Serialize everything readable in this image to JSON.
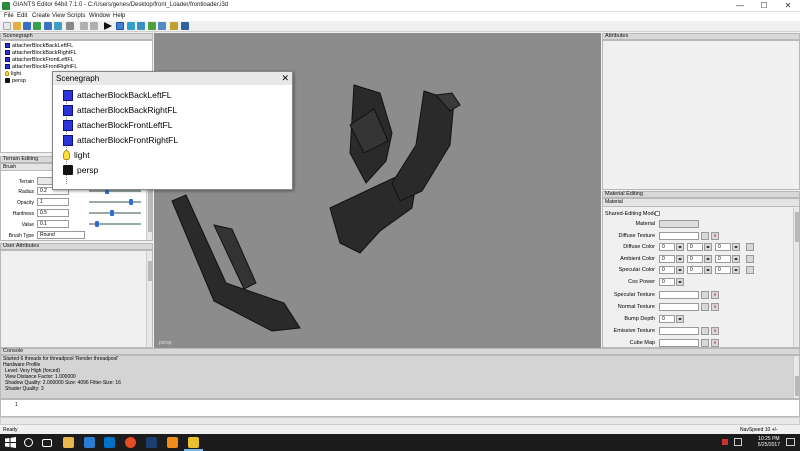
{
  "window": {
    "title": "GIANTS Editor 64bit 7.1.0 - C:/Users/genes/Desktop/front_Loader/frontloader.i3d",
    "minimize": "—",
    "maximize": "☐",
    "close": "✕"
  },
  "menu": [
    "File",
    "Edit",
    "Create",
    "View",
    "Scripts",
    "Window",
    "Help"
  ],
  "scenegraph_panel": {
    "title": "Scenegraph",
    "items": [
      "attacherBlockBackLeftFL",
      "attacherBlockBackRightFL",
      "attacherBlockFrontLeftFL",
      "attacherBlockFrontRightFL",
      "light",
      "persp"
    ]
  },
  "scenegraph_window": {
    "title": "Scenegraph",
    "close": "✕",
    "items": [
      "attacherBlockBackLeftFL",
      "attacherBlockBackRightFL",
      "attacherBlockFrontLeftFL",
      "attacherBlockFrontRightFL",
      "light",
      "persp"
    ]
  },
  "terrain": {
    "title": "Terrain Editing",
    "tab": "Brush",
    "fields": [
      {
        "label": "Terrain",
        "value": ""
      },
      {
        "label": "Radius",
        "value": "0.2"
      },
      {
        "label": "Opacity",
        "value": "1"
      },
      {
        "label": "Hardness",
        "value": "0.5"
      },
      {
        "label": "Value",
        "value": "0.1"
      }
    ],
    "brush_type_label": "Brush Type",
    "brush_type_value": "Round",
    "slider_levels": [
      0.35,
      0.8,
      0.45,
      0.15
    ]
  },
  "user_attributes": {
    "title": "User Attributes"
  },
  "viewport": {
    "label": "persp"
  },
  "attributes": {
    "title": "Attributes"
  },
  "material_editing": {
    "title": "Material Editing",
    "tab": "Material",
    "shared_label": "Shared-Editing Mode",
    "rows": [
      {
        "label": "Material"
      },
      {
        "label": "Diffuse Texture"
      },
      {
        "label": "Diffuse Color",
        "values": [
          "0",
          "0",
          "0"
        ]
      },
      {
        "label": "Ambient Color",
        "values": [
          "0",
          "0",
          "0"
        ]
      },
      {
        "label": "Specular Color",
        "values": [
          "0",
          "0",
          "0"
        ]
      },
      {
        "label": "Cos Power",
        "values": [
          "0"
        ]
      },
      {
        "label": "Specular Texture"
      },
      {
        "label": "Normal Texture"
      },
      {
        "label": "Bump Depth",
        "values": [
          "0"
        ]
      },
      {
        "label": "Emissive Texture"
      },
      {
        "label": "Cube Map"
      }
    ]
  },
  "console": {
    "title": "Console",
    "lines": [
      "Started 6 threads for threadpool 'Render threadpool'",
      "Hardware Profile",
      "  Level: Very High (forced)",
      "  View Distance Factor: 1.000000",
      "  Shadow Quality: 2.000000 Size: 4096 Filter-Size: 16",
      "  Shader Quality: 3"
    ],
    "input_line": "1"
  },
  "status": {
    "left": "Ready",
    "right": "NavSpeed 10 +/-"
  },
  "taskbar": {
    "time": "10:25 PM",
    "date": "5/25/2017"
  },
  "colors": {
    "viewport_bg": "#8c8c8c",
    "cube_blue": "#2b34d8",
    "taskbar": "#1c1c1c"
  }
}
